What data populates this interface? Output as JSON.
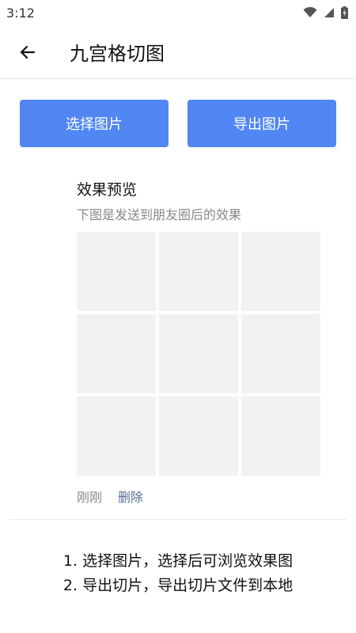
{
  "status_bar": {
    "time": "3:12",
    "icons": [
      "wifi-icon",
      "signal-icon",
      "battery-charging-icon"
    ]
  },
  "app_bar": {
    "back_icon": "back-arrow-icon",
    "title": "九宫格切图"
  },
  "actions": {
    "select_image_label": "选择图片",
    "export_image_label": "导出图片",
    "accent_color": "#5187f2"
  },
  "preview": {
    "title": "效果预览",
    "subtitle": "下图是发送到朋友圈后的效果",
    "grid_cells": 9,
    "time_text": "刚刚",
    "delete_label": "删除"
  },
  "instructions": {
    "line1": "1. 选择图片，选择后可浏览效果图",
    "line2": "2. 导出切片，导出切片文件到本地"
  }
}
